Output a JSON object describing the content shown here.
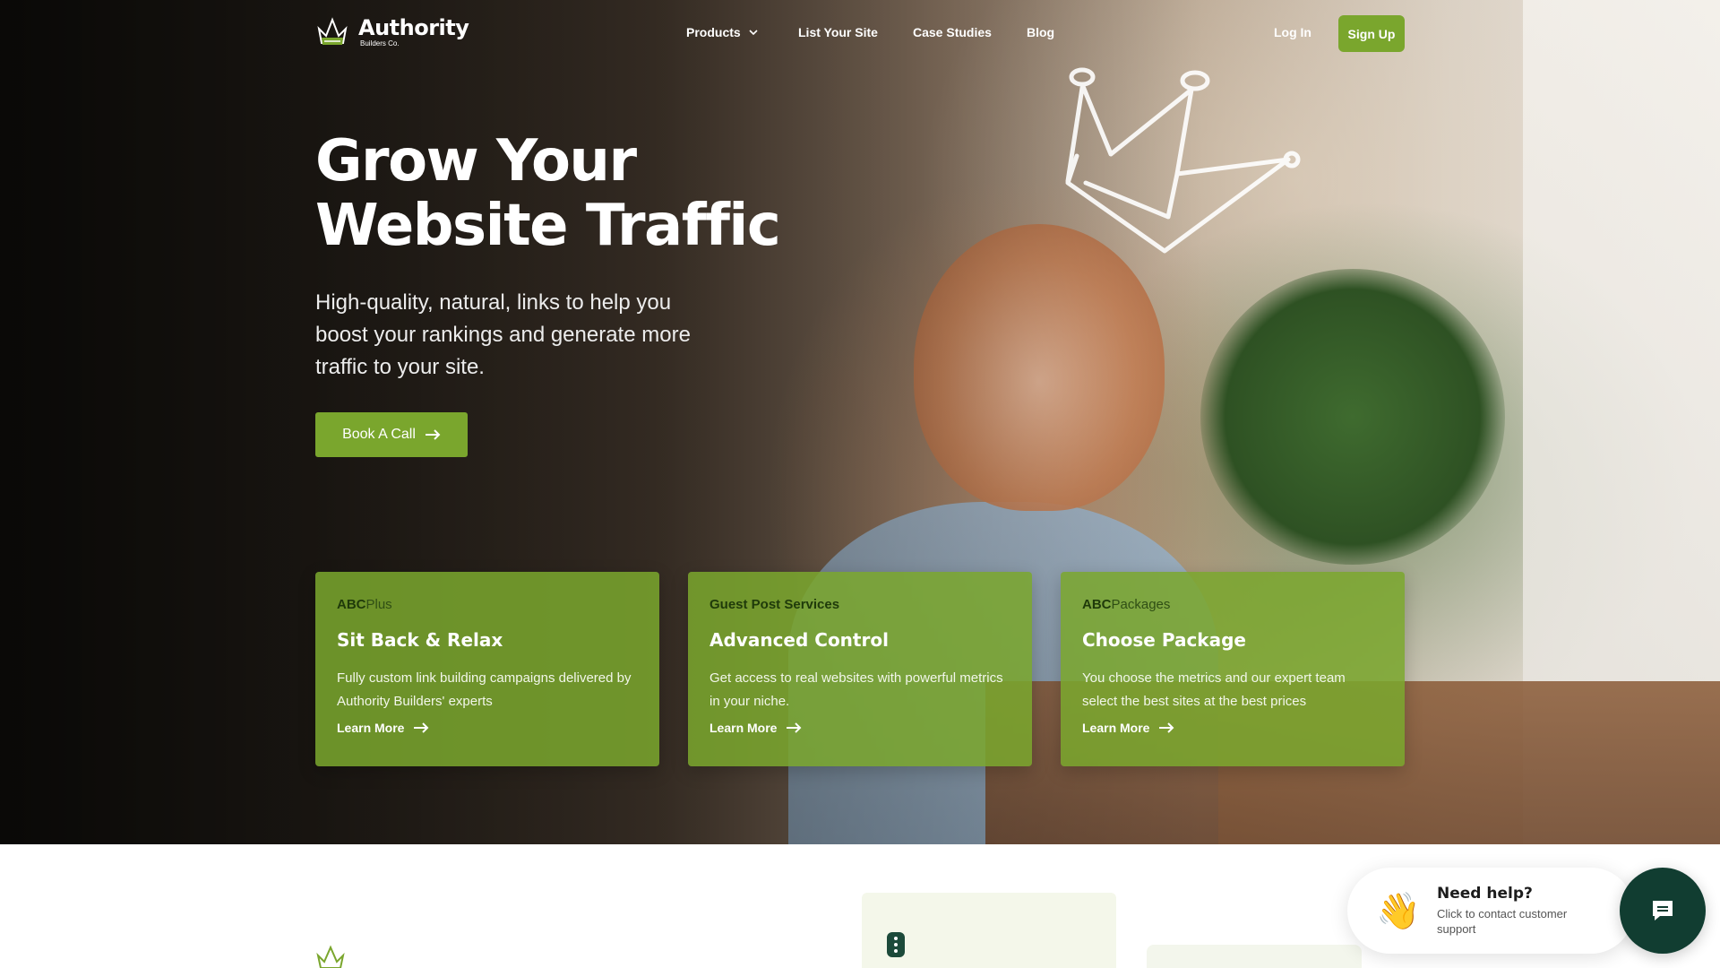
{
  "brand": {
    "name": "Authority",
    "sub": "Builders Co.",
    "accent": "#7aa62d",
    "dark": "#113d31"
  },
  "nav": {
    "products": "Products",
    "list_site": "List Your Site",
    "case_studies": "Case Studies",
    "blog": "Blog",
    "login": "Log In",
    "signup": "Sign Up"
  },
  "hero": {
    "headline_line1": "Grow Your",
    "headline_line2": "Website Traffic",
    "subtext": "High-quality, natural, links to help you boost your rankings and generate more traffic to your site.",
    "cta": "Book A Call"
  },
  "cards": [
    {
      "eyebrow_bold": "ABC",
      "eyebrow_rest": "Plus",
      "title": "Sit Back & Relax",
      "desc": "Fully custom link building campaigns delivered by Authority Builders' experts",
      "link": "Learn More"
    },
    {
      "eyebrow_bold": "Guest Post Services",
      "eyebrow_rest": "",
      "title": "Advanced Control",
      "desc": "Get access to real websites with powerful metrics in your niche.",
      "link": "Learn More"
    },
    {
      "eyebrow_bold": "ABC",
      "eyebrow_rest": "Packages",
      "title": "Choose Package",
      "desc": "You choose the metrics and our expert team select the best sites at the best prices",
      "link": "Learn More"
    }
  ],
  "help": {
    "title": "Need help?",
    "sub": "Click to contact customer support",
    "emoji": "👋"
  }
}
